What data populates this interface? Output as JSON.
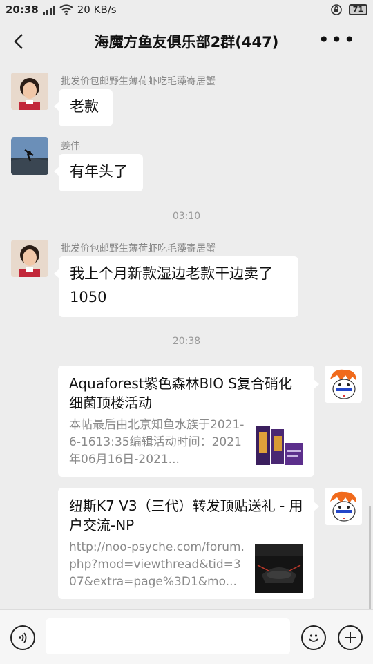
{
  "status_bar": {
    "time": "20:38",
    "network_type": "3G",
    "speed": "20 KB/s",
    "battery": "71"
  },
  "header": {
    "title": "海魔方鱼友俱乐部2群(447)"
  },
  "messages": [
    {
      "sender": "批发价包邮野生薄荷虾吃毛藻寄居蟹",
      "text": "老款"
    },
    {
      "sender": "姜伟",
      "text": "有年头了"
    },
    {
      "sender": "批发价包邮野生薄荷虾吃毛藻寄居蟹",
      "text": "我上个月新款湿边老款干边卖了1050"
    }
  ],
  "timestamps": [
    "03:10",
    "20:38"
  ],
  "shared_cards": [
    {
      "title": "Aquaforest紫色森林BIO S复合硝化细菌顶楼活动",
      "description": "本帖最后由北京知鱼水族于2021-6-1613:35编辑活动时间：2021年06月16日-2021..."
    },
    {
      "title": "纽斯K7 V3（三代）转发顶贴送礼 - 用户交流-NP",
      "description": "http://noo-psyche.com/forum.php?mod=viewthread&tid=307&extra=page%3D1&mo..."
    }
  ],
  "icons": {
    "back": "back-arrow-icon",
    "more": "more-icon",
    "voice": "voice-icon",
    "emoji": "emoji-icon",
    "add": "add-icon"
  }
}
